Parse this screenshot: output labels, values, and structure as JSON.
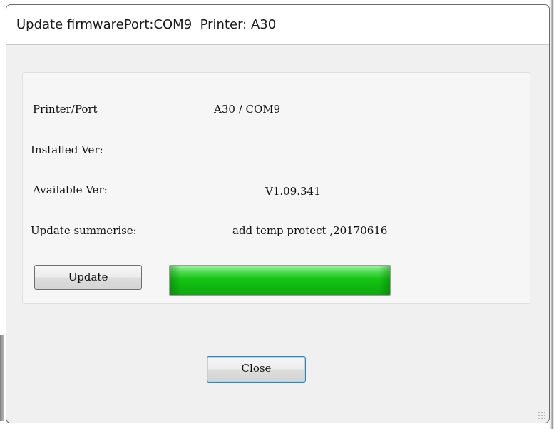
{
  "window": {
    "title": "Update firmwarePort:COM9  Printer: A30"
  },
  "info": {
    "printer_port_label": "Printer/Port",
    "printer_port_value": "A30 / COM9",
    "installed_ver_label": "Installed Ver:",
    "installed_ver_value": "",
    "available_ver_label": "Available Ver:",
    "available_ver_value": "V1.09.341",
    "summary_label": "Update summerise:",
    "summary_value": "add temp protect ,20170616"
  },
  "update_button": {
    "label": "Update"
  },
  "progress": {
    "fraction": 1.0,
    "color": "#1ec81e"
  },
  "close_button": {
    "label": "Close"
  },
  "colors": {
    "window_background": "#f0f0f0",
    "titlebar_background": "#ffffff",
    "default_button_border": "#3c7fb1"
  },
  "icons": {
    "resize_grip": "resize-grip-icon"
  }
}
